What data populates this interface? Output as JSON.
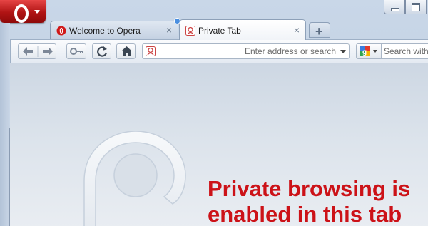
{
  "window": {
    "app": "Opera",
    "menu_button_icon": "opera-logo-icon"
  },
  "tabs": [
    {
      "label": "Welcome to Opera",
      "icon": "opera-logo-icon",
      "active": false,
      "close": "×"
    },
    {
      "label": "Private Tab",
      "icon": "private-mask-icon",
      "active": true,
      "close": "×"
    }
  ],
  "new_tab": {
    "label": "+"
  },
  "toolbar": {
    "buttons": [
      "back-arrow-icon",
      "forward-arrow-icon",
      "key-icon",
      "reload-icon",
      "home-icon"
    ],
    "address_placeholder": "Enter address or search",
    "search_placeholder": "Search with Google",
    "search_engine_icon": "google-icon"
  },
  "content": {
    "message_line1": "Private browsing is",
    "message_line2": "enabled in this tab",
    "message_color": "#cc1218"
  }
}
